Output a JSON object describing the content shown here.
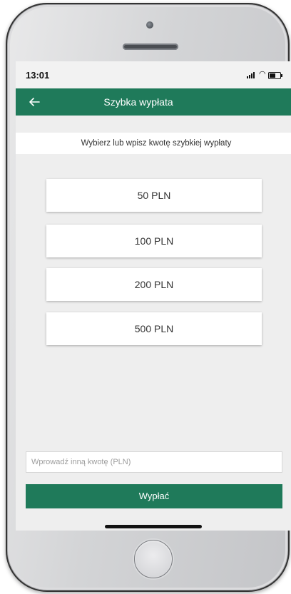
{
  "status_bar": {
    "time": "13:01",
    "icons": [
      "signal-icon",
      "wifi-icon",
      "battery-icon"
    ]
  },
  "app_bar": {
    "title": "Szybka wypłata",
    "back_icon": "arrow-left-icon"
  },
  "subtitle": "Wybierz lub wpisz kwotę szybkiej wypłaty",
  "amounts": [
    "50 PLN",
    "100 PLN",
    "200 PLN",
    "500 PLN"
  ],
  "custom_amount": {
    "placeholder": "Wprowadź inną kwotę (PLN)",
    "value": ""
  },
  "pay_button": {
    "label": "Wypłać"
  },
  "colors": {
    "accent": "#1f7a5a",
    "background": "#eeeeee",
    "card": "#ffffff"
  }
}
